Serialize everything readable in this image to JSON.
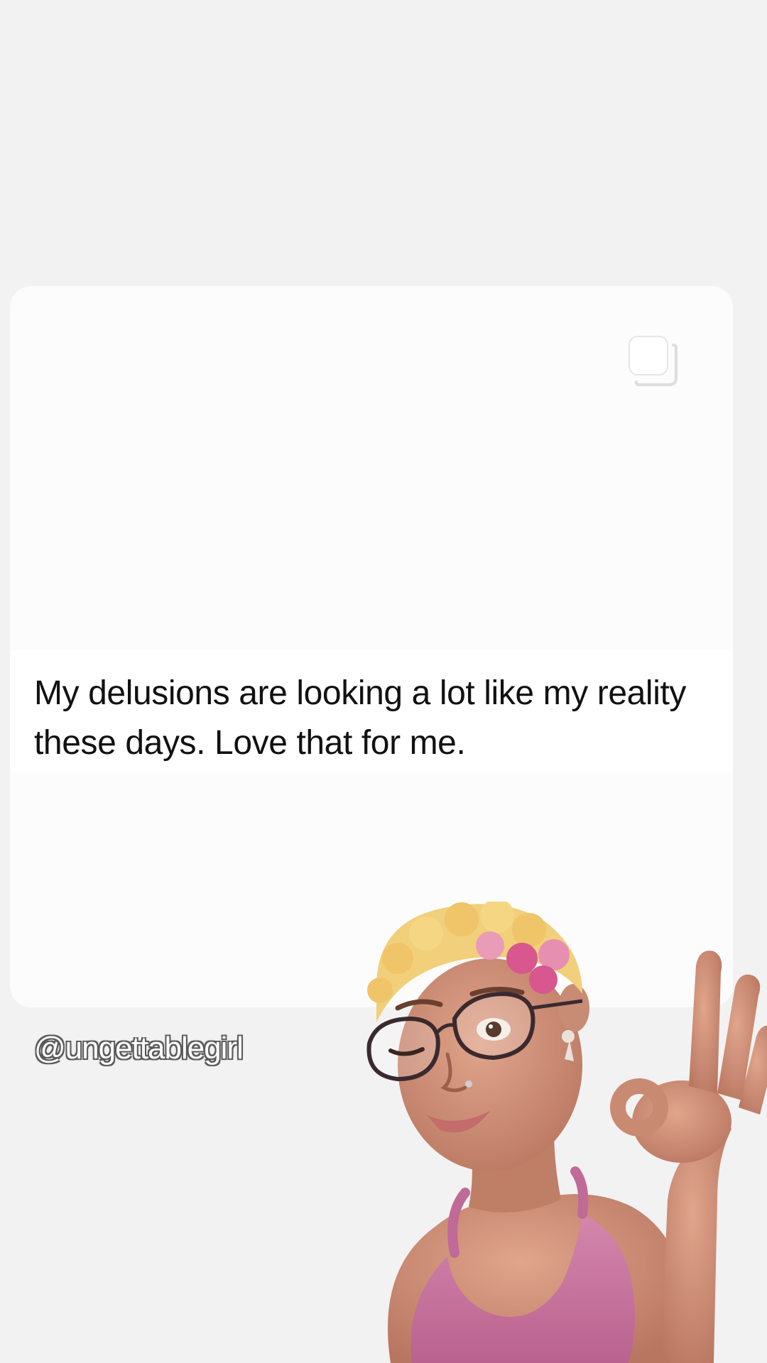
{
  "post": {
    "text": "My delusions are looking a lot like my reality these days. Love that for me.",
    "multi_icon": "multiple-images-icon"
  },
  "overlay": {
    "username": "@ungettablegirl",
    "avatar": "winking-avatar-ok-hand"
  },
  "colors": {
    "background": "#f2f2f2",
    "card": "#fcfcfc",
    "text": "#111111",
    "top_color": "#c7729f",
    "hair_blonde": "#f2cf7a",
    "hair_pink": "#d8578f",
    "skin": "#c98a72"
  }
}
